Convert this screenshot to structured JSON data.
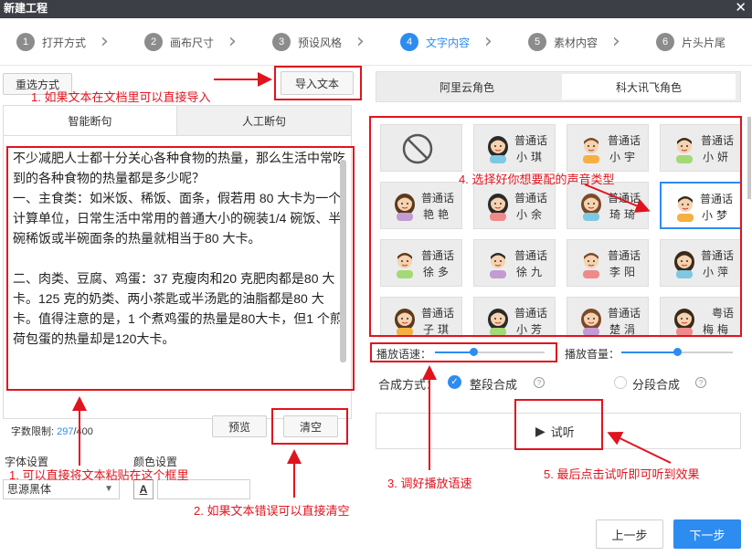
{
  "window": {
    "title": "新建工程"
  },
  "steps": [
    {
      "num": "1",
      "label": "打开方式"
    },
    {
      "num": "2",
      "label": "画布尺寸"
    },
    {
      "num": "3",
      "label": "预设风格"
    },
    {
      "num": "4",
      "label": "文字内容"
    },
    {
      "num": "5",
      "label": "素材内容"
    },
    {
      "num": "6",
      "label": "片头片尾"
    }
  ],
  "left": {
    "reselect": "重选方式",
    "import_text": "导入文本",
    "tabs": [
      "智能断句",
      "人工断句"
    ],
    "content": "不少减肥人士都十分关心各种食物的热量，那么生活中常吃到的各种食物的热量都是多少呢？\n一、主食类：如米饭、稀饭、面条，假若用 80 大卡为一个计算单位，日常生活中常用的普通大小的碗装1/4 碗饭、半碗稀饭或半碗面条的热量就相当于80 大卡。\n\n二、肉类、豆腐、鸡蛋：37 克瘦肉和20 克肥肉都是80 大卡。125 克的奶类、两小茶匙或半汤匙的油脂都是80 大卡。值得注意的是，1 个煮鸡蛋的热量是80大卡，但1 个煎荷包蛋的热量却是120大卡。",
    "char_limit_label": "字数限制:",
    "char_count": "297",
    "char_max": "/400",
    "preview": "预览",
    "clear": "清空",
    "font_label": "字体设置",
    "font_value": "思源黑体",
    "color_label": "颜色设置",
    "color_icon_letter": "A"
  },
  "right": {
    "voice_tabs": [
      "阿里云角色",
      "科大讯飞角色"
    ],
    "voices": [
      {
        "l1": "",
        "l2": "",
        "avatar": "none"
      },
      {
        "l1": "普通话",
        "l2": "小琪",
        "avatar": "girl"
      },
      {
        "l1": "普通话",
        "l2": "小宇",
        "avatar": "boy"
      },
      {
        "l1": "普通话",
        "l2": "小妍",
        "avatar": "man"
      },
      {
        "l1": "普通话",
        "l2": "艳艳",
        "avatar": "woman"
      },
      {
        "l1": "普通话",
        "l2": "小余",
        "avatar": "girl2"
      },
      {
        "l1": "普通话",
        "l2": "琦琦",
        "avatar": "girl3"
      },
      {
        "l1": "普通话",
        "l2": "小梦",
        "avatar": "boy2"
      },
      {
        "l1": "普通话",
        "l2": "徐多",
        "avatar": "man2"
      },
      {
        "l1": "普通话",
        "l2": "徐九",
        "avatar": "man3"
      },
      {
        "l1": "普通话",
        "l2": "李阳",
        "avatar": "boy3"
      },
      {
        "l1": "普通话",
        "l2": "小萍",
        "avatar": "woman2"
      },
      {
        "l1": "普通话",
        "l2": "子琪",
        "avatar": "girl4"
      },
      {
        "l1": "普通话",
        "l2": "小芳",
        "avatar": "girl5"
      },
      {
        "l1": "普通话",
        "l2": "楚涓",
        "avatar": "woman3"
      },
      {
        "l1": "粤语",
        "l2": "梅梅",
        "avatar": "woman4"
      }
    ],
    "speed_label": "播放语速：",
    "volume_label": "播放音量：",
    "synth_label": "合成方式：",
    "synth_opt1": "整段合成",
    "synth_opt2": "分段合成",
    "listen": "试听",
    "speed_value": 0.35,
    "volume_value": 0.5
  },
  "footer": {
    "prev": "上一步",
    "next": "下一步"
  },
  "annotations": {
    "a1": "1. 如果文本在文档里可以直接导入",
    "a2": "1. 可以直接将文本粘贴在这个框里",
    "a3": "2. 如果文本错误可以直接清空",
    "a4": "3. 调好播放语速",
    "a5": "4. 选择好你想要配的声音类型",
    "a6": "5. 最后点击试听即可听到效果"
  },
  "colors": {
    "accent": "#2d8cf0",
    "annotation": "#e0141e",
    "titlebar": "#3c3f46"
  }
}
